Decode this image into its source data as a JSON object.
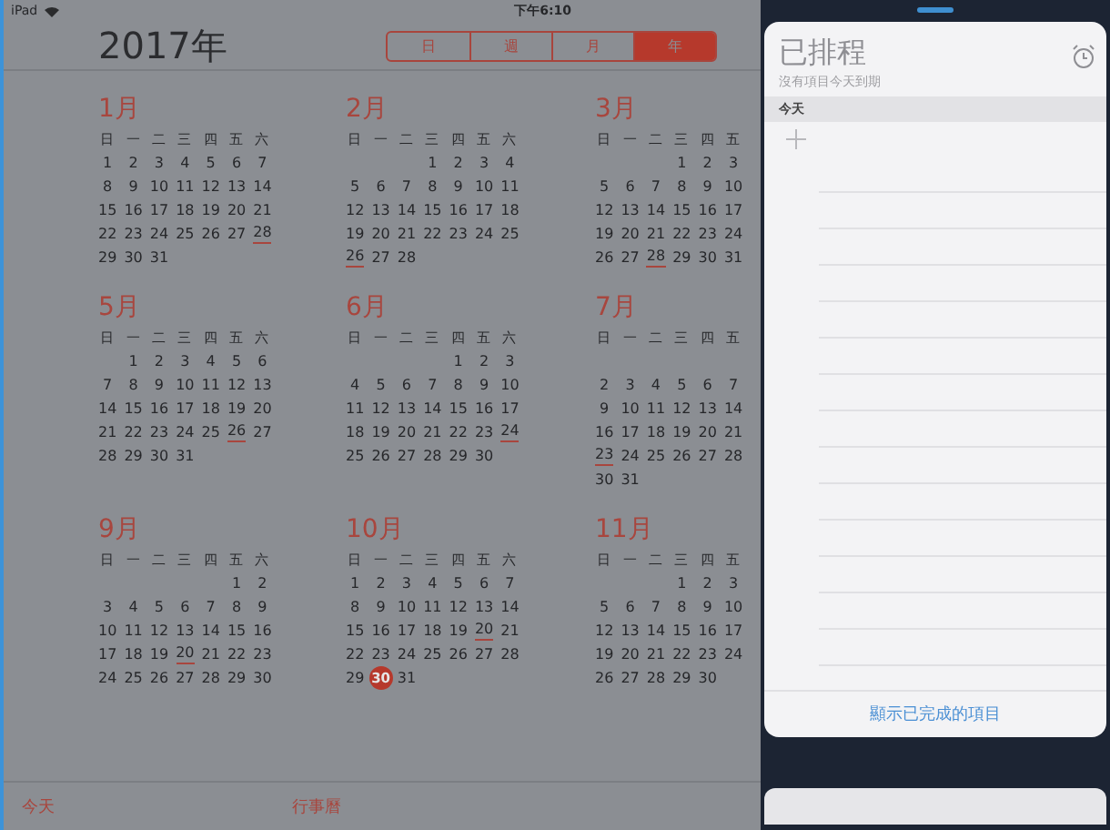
{
  "status_bar": {
    "device": "iPad",
    "time": "下午6:10"
  },
  "header": {
    "title": "2017年",
    "segments": [
      {
        "label": "日",
        "selected": false
      },
      {
        "label": "週",
        "selected": false
      },
      {
        "label": "月",
        "selected": false
      },
      {
        "label": "年",
        "selected": true
      }
    ]
  },
  "months": [
    {
      "name": "1月",
      "weekdays": [
        "日",
        "一",
        "二",
        "三",
        "四",
        "五",
        "六"
      ],
      "weeks": [
        [
          "1",
          "2",
          "3",
          "4",
          "5",
          "6",
          "7"
        ],
        [
          "8",
          "9",
          "10",
          "11",
          "12",
          "13",
          "14"
        ],
        [
          "15",
          "16",
          "17",
          "18",
          "19",
          "20",
          "21"
        ],
        [
          "22",
          "23",
          "24",
          "25",
          "26",
          "27",
          {
            "day": "28",
            "kind": "underlined"
          }
        ],
        [
          "29",
          "30",
          "31"
        ]
      ]
    },
    {
      "name": "2月",
      "weekdays": [
        "日",
        "一",
        "二",
        "三",
        "四",
        "五",
        "六"
      ],
      "weeks": [
        [
          {
            "kind": "blank"
          },
          {
            "kind": "blank"
          },
          {
            "kind": "blank"
          },
          "1",
          "2",
          "3",
          "4"
        ],
        [
          "5",
          "6",
          "7",
          "8",
          "9",
          "10",
          "11"
        ],
        [
          "12",
          "13",
          "14",
          "15",
          "16",
          "17",
          "18"
        ],
        [
          "19",
          "20",
          "21",
          "22",
          "23",
          "24",
          "25"
        ],
        [
          {
            "day": "26",
            "kind": "underlined"
          },
          "27",
          "28"
        ]
      ]
    },
    {
      "name": "3月",
      "weekdays": [
        "日",
        "一",
        "二",
        "三",
        "四",
        "五"
      ],
      "weeks": [
        [
          {
            "kind": "blank"
          },
          {
            "kind": "blank"
          },
          {
            "kind": "blank"
          },
          "1",
          "2",
          "3"
        ],
        [
          "5",
          "6",
          "7",
          "8",
          "9",
          "10"
        ],
        [
          "12",
          "13",
          "14",
          "15",
          "16",
          "17"
        ],
        [
          "19",
          "20",
          "21",
          "22",
          "23",
          "24"
        ],
        [
          "26",
          "27",
          {
            "day": "28",
            "kind": "underlined"
          },
          "29",
          "30",
          "31"
        ]
      ]
    },
    {
      "name": "5月",
      "weekdays": [
        "日",
        "一",
        "二",
        "三",
        "四",
        "五",
        "六"
      ],
      "weeks": [
        [
          {
            "kind": "blank"
          },
          "1",
          "2",
          "3",
          "4",
          "5",
          "6"
        ],
        [
          "7",
          "8",
          "9",
          "10",
          "11",
          "12",
          "13"
        ],
        [
          "14",
          "15",
          "16",
          "17",
          "18",
          "19",
          "20"
        ],
        [
          "21",
          "22",
          "23",
          "24",
          "25",
          {
            "day": "26",
            "kind": "underlined"
          },
          "27"
        ],
        [
          "28",
          "29",
          "30",
          "31"
        ]
      ]
    },
    {
      "name": "6月",
      "weekdays": [
        "日",
        "一",
        "二",
        "三",
        "四",
        "五",
        "六"
      ],
      "weeks": [
        [
          {
            "kind": "blank"
          },
          {
            "kind": "blank"
          },
          {
            "kind": "blank"
          },
          {
            "kind": "blank"
          },
          "1",
          "2",
          "3"
        ],
        [
          "4",
          "5",
          "6",
          "7",
          "8",
          "9",
          "10"
        ],
        [
          "11",
          "12",
          "13",
          "14",
          "15",
          "16",
          "17"
        ],
        [
          "18",
          "19",
          "20",
          "21",
          "22",
          "23",
          {
            "day": "24",
            "kind": "underlined"
          }
        ],
        [
          "25",
          "26",
          "27",
          "28",
          "29",
          "30"
        ]
      ]
    },
    {
      "name": "7月",
      "weekdays": [
        "日",
        "一",
        "二",
        "三",
        "四",
        "五"
      ],
      "weeks": [
        [
          {
            "kind": "blank"
          }
        ],
        [
          "2",
          "3",
          "4",
          "5",
          "6",
          "7"
        ],
        [
          "9",
          "10",
          "11",
          "12",
          "13",
          "14"
        ],
        [
          "16",
          "17",
          "18",
          "19",
          "20",
          "21"
        ],
        [
          {
            "day": "23",
            "kind": "underlined"
          },
          "24",
          "25",
          "26",
          "27",
          "28"
        ],
        [
          "30",
          "31"
        ]
      ]
    },
    {
      "name": "9月",
      "weekdays": [
        "日",
        "一",
        "二",
        "三",
        "四",
        "五",
        "六"
      ],
      "weeks": [
        [
          {
            "kind": "blank"
          },
          {
            "kind": "blank"
          },
          {
            "kind": "blank"
          },
          {
            "kind": "blank"
          },
          {
            "kind": "blank"
          },
          "1",
          "2"
        ],
        [
          "3",
          "4",
          "5",
          "6",
          "7",
          "8",
          "9"
        ],
        [
          "10",
          "11",
          "12",
          "13",
          "14",
          "15",
          "16"
        ],
        [
          "17",
          "18",
          "19",
          {
            "day": "20",
            "kind": "underlined"
          },
          "21",
          "22",
          "23"
        ],
        [
          "24",
          "25",
          "26",
          "27",
          "28",
          "29",
          "30"
        ]
      ]
    },
    {
      "name": "10月",
      "weekdays": [
        "日",
        "一",
        "二",
        "三",
        "四",
        "五",
        "六"
      ],
      "weeks": [
        [
          "1",
          "2",
          "3",
          "4",
          "5",
          "6",
          "7"
        ],
        [
          "8",
          "9",
          "10",
          "11",
          "12",
          "13",
          "14"
        ],
        [
          "15",
          "16",
          "17",
          "18",
          "19",
          {
            "day": "20",
            "kind": "underlined"
          },
          "21"
        ],
        [
          "22",
          "23",
          "24",
          "25",
          "26",
          "27",
          "28"
        ],
        [
          "29",
          {
            "day": "30",
            "kind": "today"
          },
          "31"
        ]
      ]
    },
    {
      "name": "11月",
      "weekdays": [
        "日",
        "一",
        "二",
        "三",
        "四",
        "五"
      ],
      "weeks": [
        [
          {
            "kind": "blank"
          },
          {
            "kind": "blank"
          },
          {
            "kind": "blank"
          },
          "1",
          "2",
          "3"
        ],
        [
          "5",
          "6",
          "7",
          "8",
          "9",
          "10"
        ],
        [
          "12",
          "13",
          "14",
          "15",
          "16",
          "17"
        ],
        [
          "19",
          "20",
          "21",
          "22",
          "23",
          "24"
        ],
        [
          "26",
          "27",
          "28",
          "29",
          "30"
        ]
      ]
    }
  ],
  "toolbar": {
    "left": "今天",
    "center": "行事曆"
  },
  "reminders": {
    "title": "已排程",
    "subtitle": "沒有項目今天到期",
    "section": "今天",
    "footer": "顯示已完成的項目"
  }
}
